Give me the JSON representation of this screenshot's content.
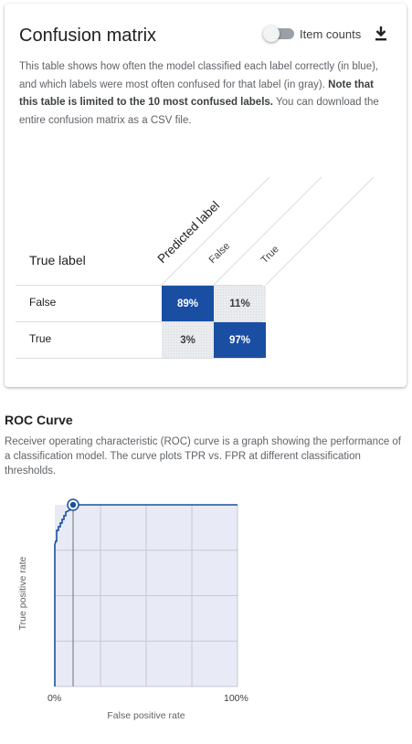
{
  "confusion_matrix": {
    "title": "Confusion matrix",
    "toggle_label": "Item counts",
    "toggle_on": false,
    "download_icon": "download-icon",
    "description_part1": "This table shows how often the model classified each label correctly (in blue), and which labels were most often confused for that label (in gray).",
    "description_bold": "Note that this table is limited to the 10 most confused labels.",
    "description_part2": "You can download the entire confusion matrix as a CSV file.",
    "predicted_label_header": "Predicted label",
    "true_label_header": "True label",
    "columns": [
      "False",
      "True"
    ],
    "rows": [
      {
        "label": "False",
        "cells": [
          "89%",
          "11%"
        ]
      },
      {
        "label": "True",
        "cells": [
          "3%",
          "97%"
        ]
      }
    ],
    "colors": {
      "correct": "#1a4ea3",
      "confused": "#eaecee"
    }
  },
  "roc": {
    "title": "ROC Curve",
    "description": "Receiver operating characteristic (ROC) curve is a graph showing the performance of a classification model. The curve plots TPR vs. FPR at different classification thresholds.",
    "xlabel": "False positive rate",
    "ylabel": "True positive rate",
    "x_tick_min": "0%",
    "x_tick_max": "100%"
  },
  "chart_data": {
    "type": "line",
    "title": "ROC Curve",
    "xlabel": "False positive rate",
    "ylabel": "True positive rate",
    "xlim": [
      0,
      1
    ],
    "ylim": [
      0,
      1
    ],
    "x_ticks": [
      "0%",
      "100%"
    ],
    "grid": true,
    "colors": {
      "line": "#1a4ea3",
      "fill": "#e8eaf6",
      "grid": "#c5c9d3"
    },
    "series": [
      {
        "x": [
          0,
          0,
          0.005,
          0.01,
          0.01,
          0.02,
          0.02,
          0.03,
          0.03,
          0.04,
          0.04,
          0.05,
          0.05,
          0.06,
          0.06,
          0.08,
          0.09,
          0.1,
          0.1,
          0.12,
          0.14,
          1.0
        ],
        "y": [
          0,
          0.78,
          0.8,
          0.8,
          0.86,
          0.86,
          0.88,
          0.88,
          0.9,
          0.9,
          0.92,
          0.92,
          0.94,
          0.94,
          0.96,
          0.97,
          0.98,
          0.98,
          1.0,
          1.0,
          1.0,
          1.0
        ]
      }
    ],
    "marker": {
      "x": 0.1,
      "y": 1.0
    }
  }
}
